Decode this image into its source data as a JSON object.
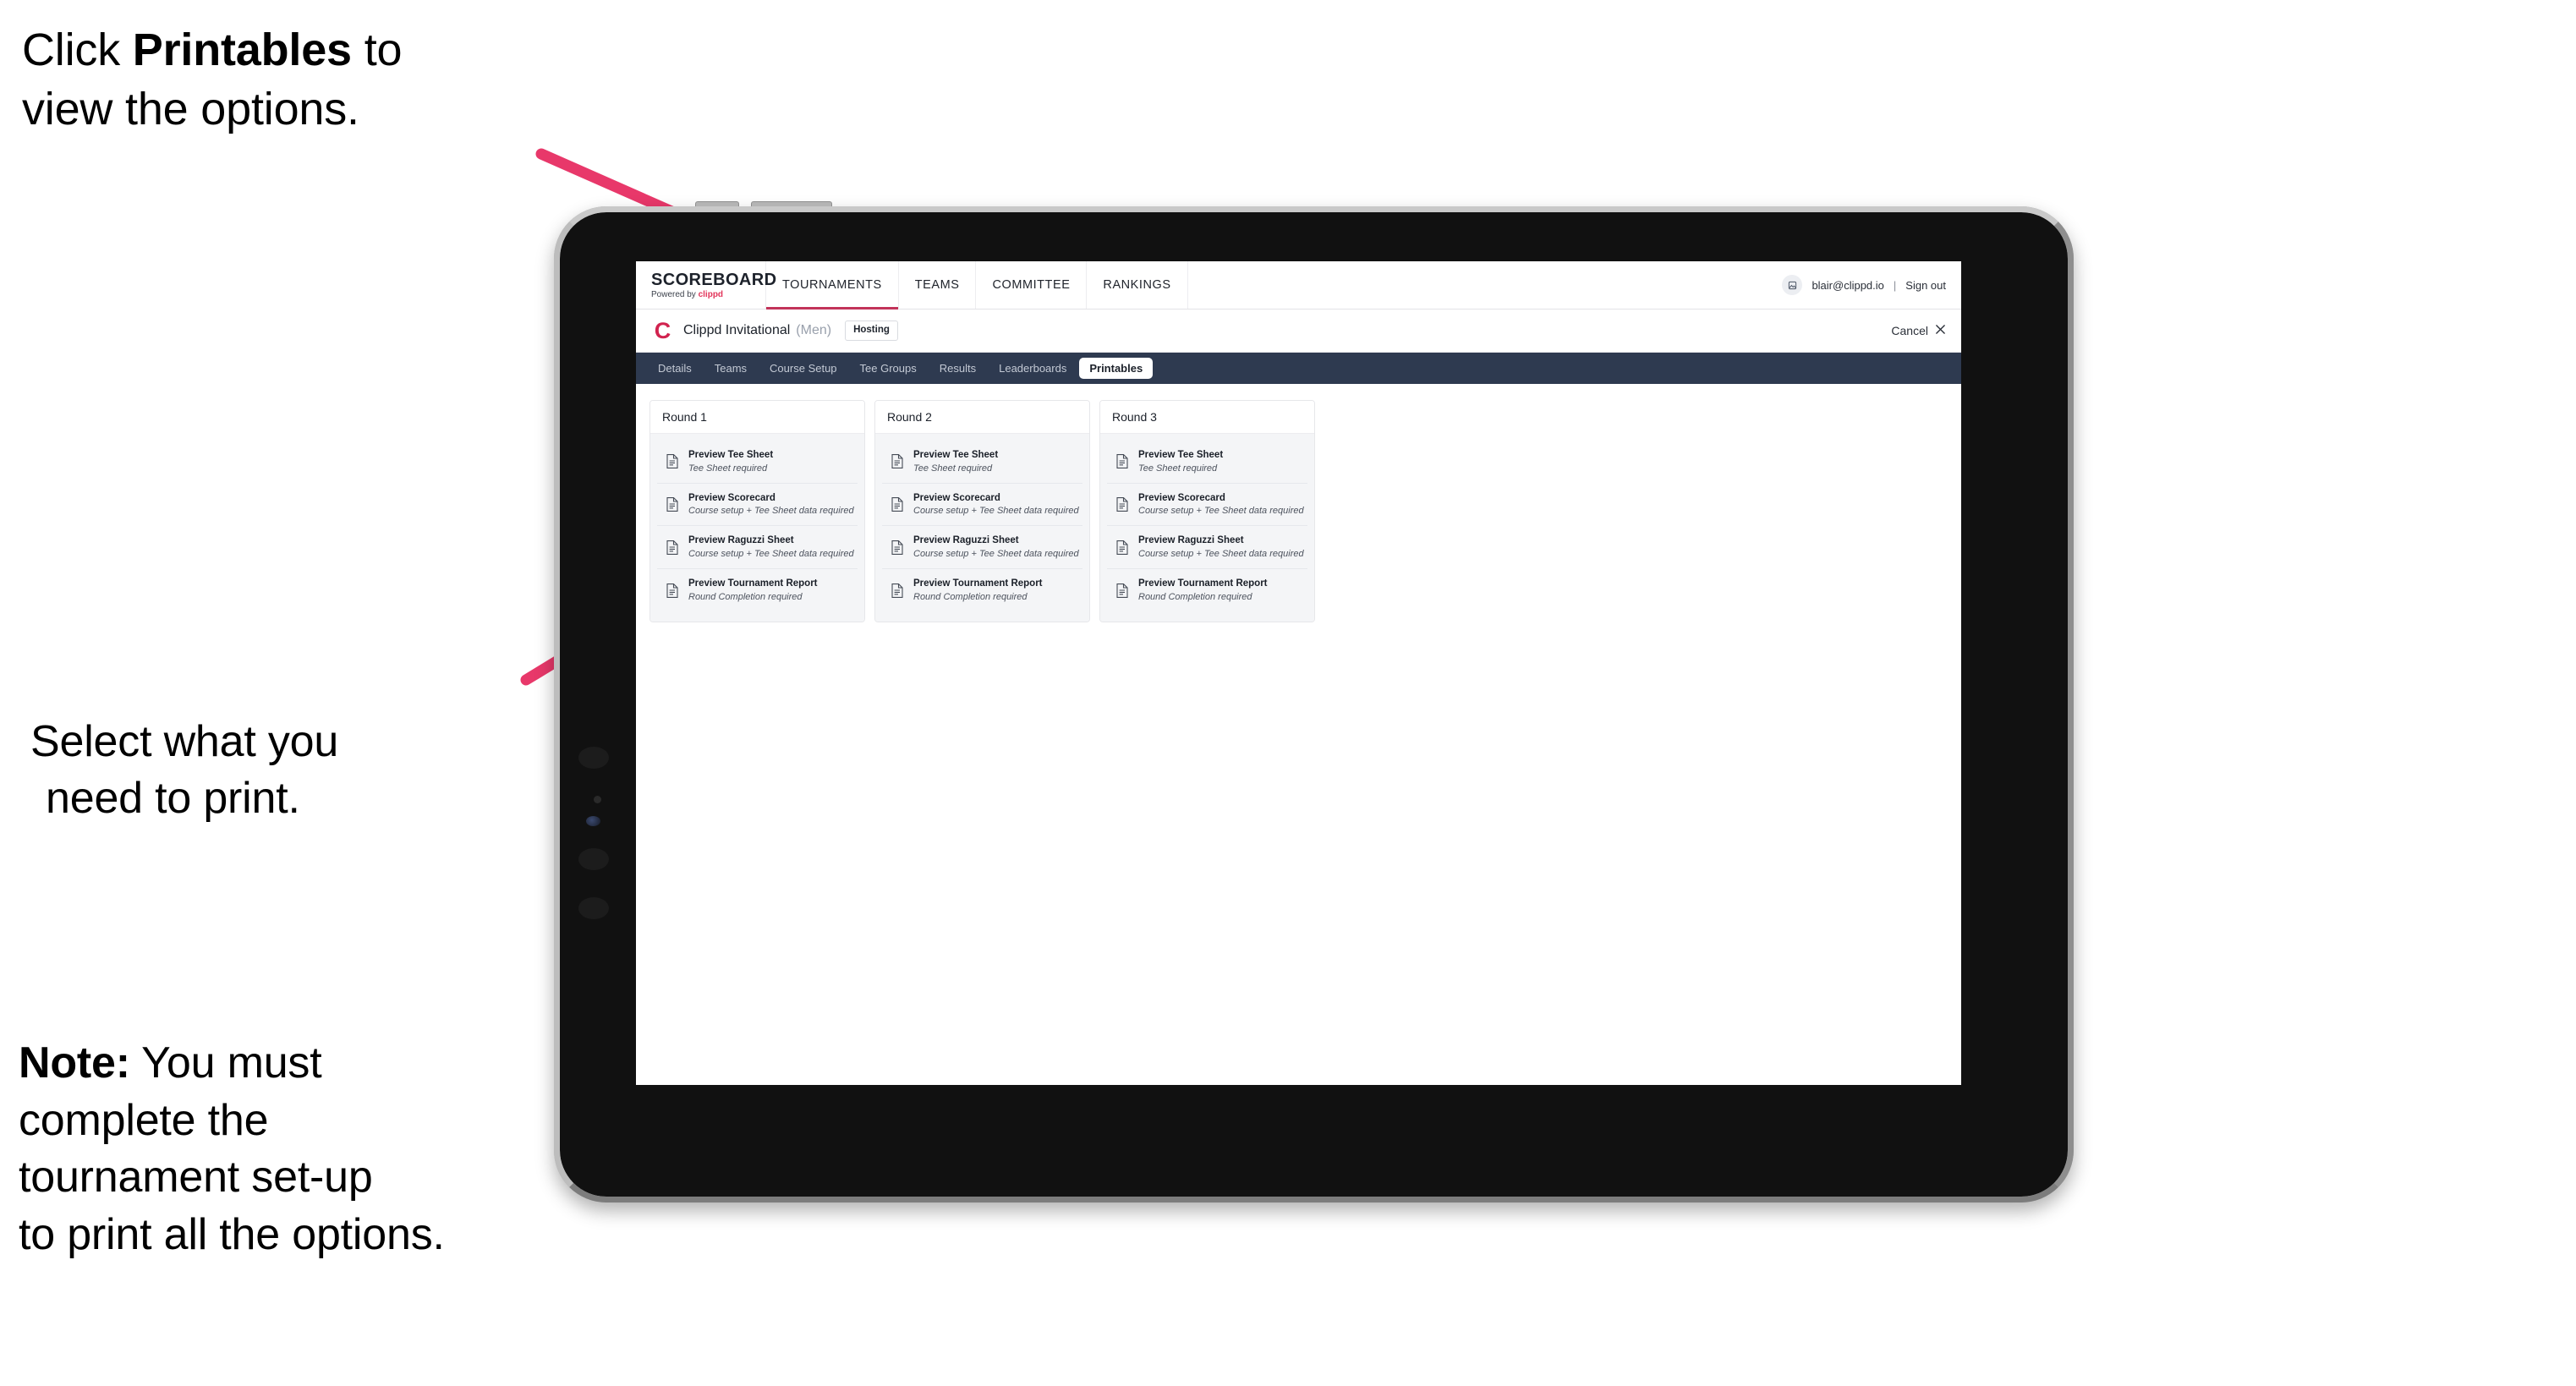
{
  "annotations": {
    "click_printables": {
      "prefix": "Click ",
      "bold": "Printables",
      "suffix": " to\nview the options."
    },
    "select_print": {
      "line1": "Select what you",
      "line2": "need to print."
    },
    "note": {
      "label": "Note:",
      "body": " You must\ncomplete the\ntournament set-up\nto print all the options."
    }
  },
  "colors": {
    "accent_pink": "#e8386a",
    "brand_red": "#d1234f",
    "tab_navy": "#2e3a50",
    "nav_underline": "#c2335a"
  },
  "browser": {
    "topnav": {
      "brand": {
        "title": "SCOREBOARD",
        "powered_prefix": "Powered by ",
        "powered_brand": "clippd"
      },
      "items": [
        {
          "label": "TOURNAMENTS",
          "active": true
        },
        {
          "label": "TEAMS",
          "active": false
        },
        {
          "label": "COMMITTEE",
          "active": false
        },
        {
          "label": "RANKINGS",
          "active": false
        }
      ],
      "user": {
        "avatar_icon": "user-avatar-icon",
        "email": "blair@clippd.io",
        "separator": "|",
        "sign_out": "Sign out"
      }
    },
    "subheader": {
      "logo_letter": "C",
      "tournament_name": "Clippd Invitational",
      "gender": "(Men)",
      "badge": "Hosting",
      "cancel_label": "Cancel",
      "cancel_icon": "close-icon"
    },
    "tabs": [
      {
        "label": "Details",
        "active": false
      },
      {
        "label": "Teams",
        "active": false
      },
      {
        "label": "Course Setup",
        "active": false
      },
      {
        "label": "Tee Groups",
        "active": false
      },
      {
        "label": "Results",
        "active": false
      },
      {
        "label": "Leaderboards",
        "active": false
      },
      {
        "label": "Printables",
        "active": true
      }
    ],
    "rounds": [
      {
        "title": "Round 1",
        "items": [
          {
            "title": "Preview Tee Sheet",
            "sub": "Tee Sheet required"
          },
          {
            "title": "Preview Scorecard",
            "sub": "Course setup + Tee Sheet data required"
          },
          {
            "title": "Preview Raguzzi Sheet",
            "sub": "Course setup + Tee Sheet data required"
          },
          {
            "title": "Preview Tournament Report",
            "sub": "Round Completion required"
          }
        ]
      },
      {
        "title": "Round 2",
        "items": [
          {
            "title": "Preview Tee Sheet",
            "sub": "Tee Sheet required"
          },
          {
            "title": "Preview Scorecard",
            "sub": "Course setup + Tee Sheet data required"
          },
          {
            "title": "Preview Raguzzi Sheet",
            "sub": "Course setup + Tee Sheet data required"
          },
          {
            "title": "Preview Tournament Report",
            "sub": "Round Completion required"
          }
        ]
      },
      {
        "title": "Round 3",
        "items": [
          {
            "title": "Preview Tee Sheet",
            "sub": "Tee Sheet required"
          },
          {
            "title": "Preview Scorecard",
            "sub": "Course setup + Tee Sheet data required"
          },
          {
            "title": "Preview Raguzzi Sheet",
            "sub": "Course setup + Tee Sheet data required"
          },
          {
            "title": "Preview Tournament Report",
            "sub": "Round Completion required"
          }
        ]
      }
    ]
  }
}
